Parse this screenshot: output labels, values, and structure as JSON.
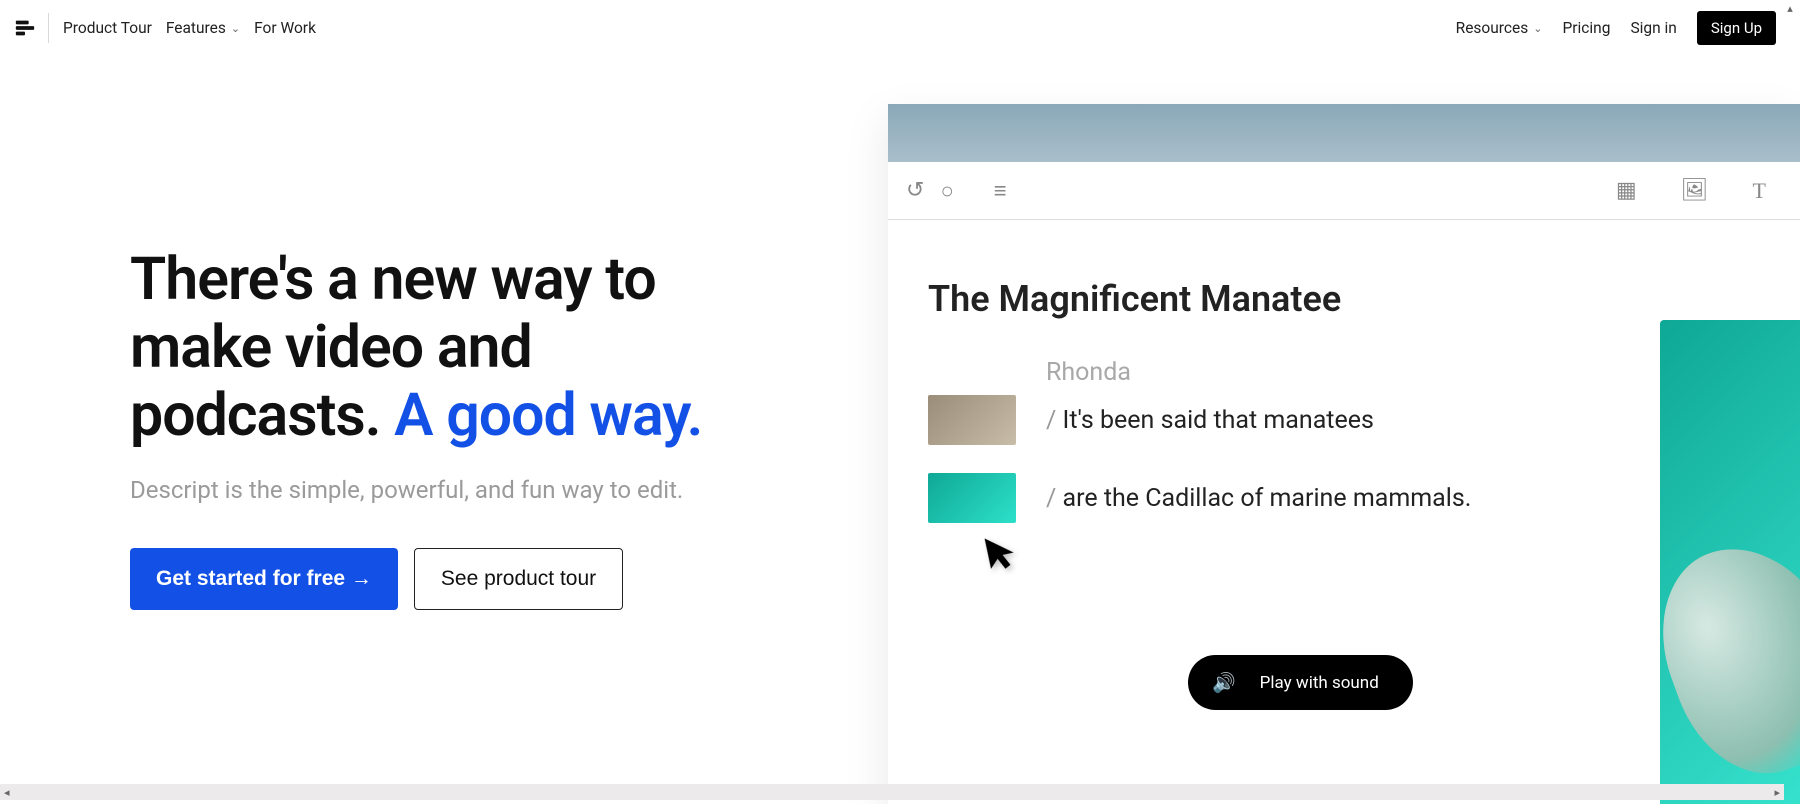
{
  "nav": {
    "items": {
      "product_tour": "Product Tour",
      "features": "Features",
      "for_work": "For Work",
      "resources": "Resources",
      "pricing": "Pricing",
      "sign_in": "Sign in",
      "sign_up": "Sign Up"
    }
  },
  "hero": {
    "headline_part1": "There's a new way to make video and podcasts. ",
    "headline_accent": "A good way.",
    "sub": "Descript is the simple, powerful, and fun way to edit.",
    "cta_primary": "Get started for free →",
    "cta_secondary": "See product tour"
  },
  "preview": {
    "doc_title": "The Magnificent Manatee",
    "speaker": "Rhonda",
    "line1_prefix": "/ ",
    "line1_text": "It's been said that manatees",
    "line2_prefix": "/ ",
    "line2_text": "are the Cadillac of marine mammals.",
    "play_label": "Play with sound"
  }
}
